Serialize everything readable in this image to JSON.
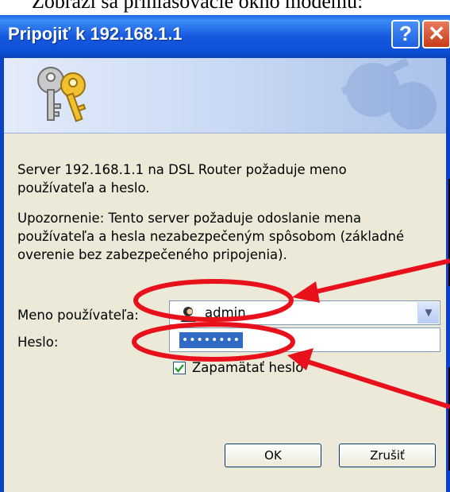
{
  "caption": "Zobrazí sa prihlasovacie okno modemu:",
  "window": {
    "title": "Pripojiť k 192.168.1.1",
    "help_glyph": "?",
    "close_glyph": "✕"
  },
  "dialog": {
    "message": "Server 192.168.1.1 na DSL Router požaduje meno používateľa a heslo.",
    "warning": "Upozornenie: Tento server požaduje odoslanie mena používateľa a hesla nezabezpečeným spôsobom (základné overenie bez zabezpečeného pripojenia).",
    "username_label": "Meno používateľa:",
    "username_value": "admin",
    "password_label": "Heslo:",
    "password_mask": "••••••••",
    "remember_label": "Zapamätať heslo",
    "remember_checked": true,
    "ok_label": "OK",
    "cancel_label": "Zrušiť"
  },
  "annotations": {
    "color": "#e8101a"
  },
  "icons": [
    "keys-icon",
    "user-icon",
    "chevron-down-icon",
    "checkmark-icon",
    "help-icon",
    "close-icon"
  ]
}
